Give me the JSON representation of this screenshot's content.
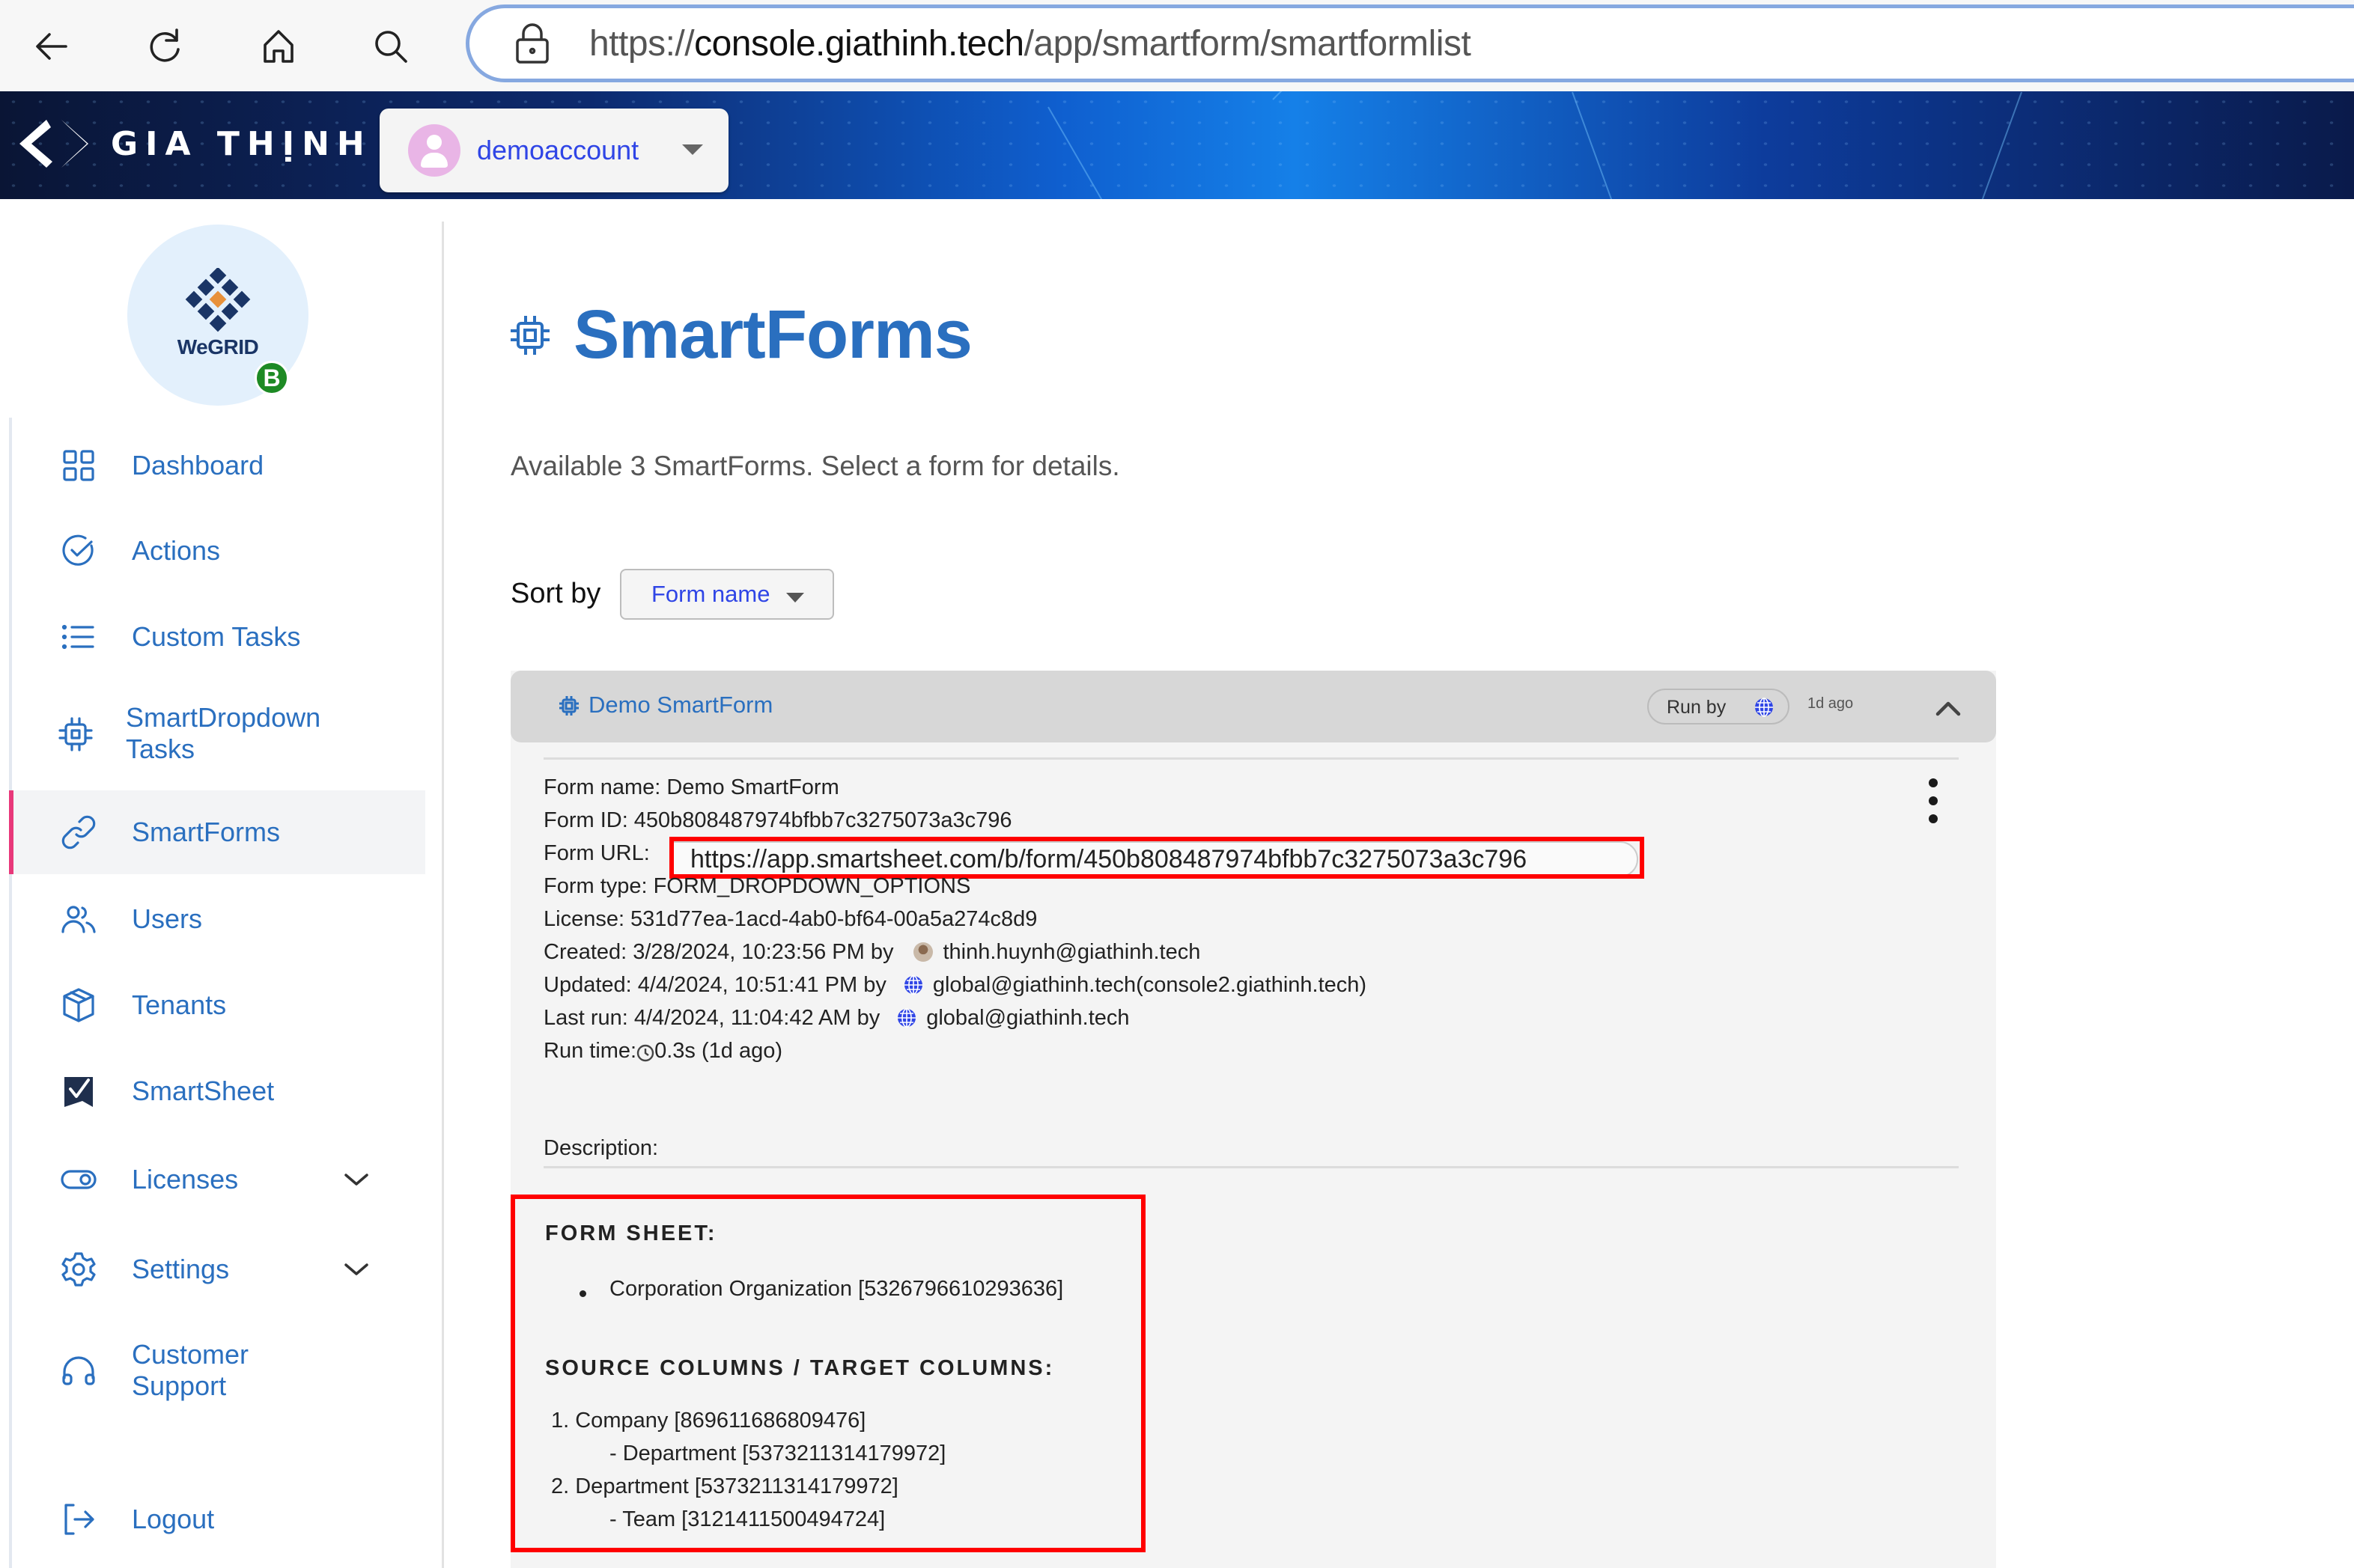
{
  "browser": {
    "url_prefix": "https://",
    "url_host": "console.giathinh.tech",
    "url_path": "/app/smartform/smartformlist",
    "buttons": [
      "back",
      "reload",
      "home",
      "search"
    ]
  },
  "header": {
    "brand": "GIA THỊNH",
    "account_name": "demoaccount"
  },
  "sidebar": {
    "logo_text": "WeGRID",
    "logo_badge": "B",
    "items": [
      {
        "label": "Dashboard",
        "icon": "grid-icon"
      },
      {
        "label": "Actions",
        "icon": "check-circle-icon"
      },
      {
        "label": "Custom Tasks",
        "icon": "list-icon"
      },
      {
        "label": "SmartDropdown",
        "label2": "Tasks",
        "icon": "chip-icon"
      },
      {
        "label": "SmartForms",
        "icon": "link-icon",
        "active": true
      },
      {
        "label": "Users",
        "icon": "users-icon"
      },
      {
        "label": "Tenants",
        "icon": "box-icon"
      },
      {
        "label": "SmartSheet",
        "icon": "smartsheet-icon"
      },
      {
        "label": "Licenses",
        "icon": "toggle-icon",
        "expandable": true
      },
      {
        "label": "Settings",
        "icon": "gear-icon",
        "expandable": true
      },
      {
        "label": "Customer",
        "label2": "Support",
        "icon": "headset-icon"
      },
      {
        "label": "Logout",
        "icon": "logout-icon"
      }
    ]
  },
  "main": {
    "title": "SmartForms",
    "subtitle": "Available 3 SmartForms. Select a form for details.",
    "sort_label": "Sort by",
    "sort_value": "Form name"
  },
  "form_card": {
    "title": "Demo SmartForm",
    "run_by_label": "Run by",
    "time_ago": "1d ago",
    "details": {
      "form_name_label": "Form name:",
      "form_name": "Demo SmartForm",
      "form_id_label": "Form ID:",
      "form_id": "450b808487974bfbb7c3275073a3c796",
      "form_url_label": "Form URL:",
      "form_url": "https://app.smartsheet.com/b/form/450b808487974bfbb7c3275073a3c796",
      "form_type_label": "Form type:",
      "form_type": "FORM_DROPDOWN_OPTIONS",
      "license_label": "License:",
      "license": "531d77ea-1acd-4ab0-bf64-00a5a274c8d9",
      "created_label": "Created:",
      "created": "3/28/2024, 10:23:56 PM by",
      "created_by": "thinh.huynh@giathinh.tech",
      "updated_label": "Updated:",
      "updated": "4/4/2024, 10:51:41 PM by",
      "updated_by": "global@giathinh.tech(console2.giathinh.tech)",
      "last_run_label": "Last run:",
      "last_run": "4/4/2024, 11:04:42 AM by",
      "last_run_by": "global@giathinh.tech",
      "run_time_label": "Run time:",
      "run_time": "0.3s (1d ago)"
    },
    "description_label": "Description:",
    "description": {
      "form_sheet_heading": "FORM SHEET:",
      "form_sheet_item": "Corporation Organization [5326796610293636]",
      "columns_heading": "SOURCE COLUMNS / TARGET COLUMNS:",
      "columns": [
        {
          "source": "1. Company [869611686809476]",
          "target": "- Department [5373211314179972]"
        },
        {
          "source": "2. Department [5373211314179972]",
          "target": "- Team [3121411500494724]"
        }
      ]
    },
    "colors": {
      "accent": "#2a6fbf",
      "highlight": "#ff0000",
      "active_marker": "#e8387a"
    }
  }
}
